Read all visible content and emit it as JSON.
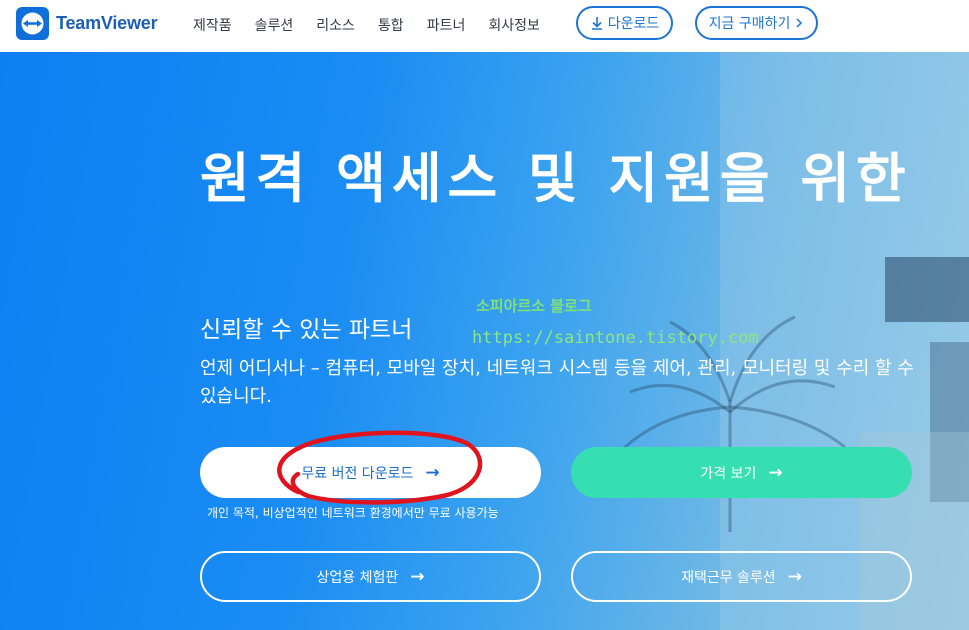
{
  "header": {
    "logo_text": "TeamViewer",
    "nav": [
      "제작품",
      "솔루션",
      "리소스",
      "통합",
      "파트너",
      "회사정보"
    ],
    "download_label": "다운로드",
    "buy_label": "지금 구매하기"
  },
  "hero": {
    "title": "원격 액세스 및 지원을 위한",
    "subtitle": "신뢰할 수 있는 파트너",
    "description": "언제 어디서나 – 컴퓨터, 모바일 장치, 네트워크 시스템 등을 제어, 관리, 모니터링 및 수리 할 수 있습니다.",
    "watermark_line1": "소피아르소 블로그",
    "watermark_line2": "https://saintone.tistory.com",
    "buttons": {
      "free_download": "무료 버전 다운로드",
      "view_pricing": "가격 보기",
      "commercial_trial": "상업용 체험판",
      "remote_work": "재택근무 솔루션"
    },
    "free_note": "개인 목적, 비상업적인 네트워크 환경에서만 무료 사용가능"
  },
  "colors": {
    "brand_blue": "#1b74d6",
    "hero_blue": "#0d7ff2",
    "price_green": "#35dfb2",
    "annotation_red": "#e0141e"
  }
}
